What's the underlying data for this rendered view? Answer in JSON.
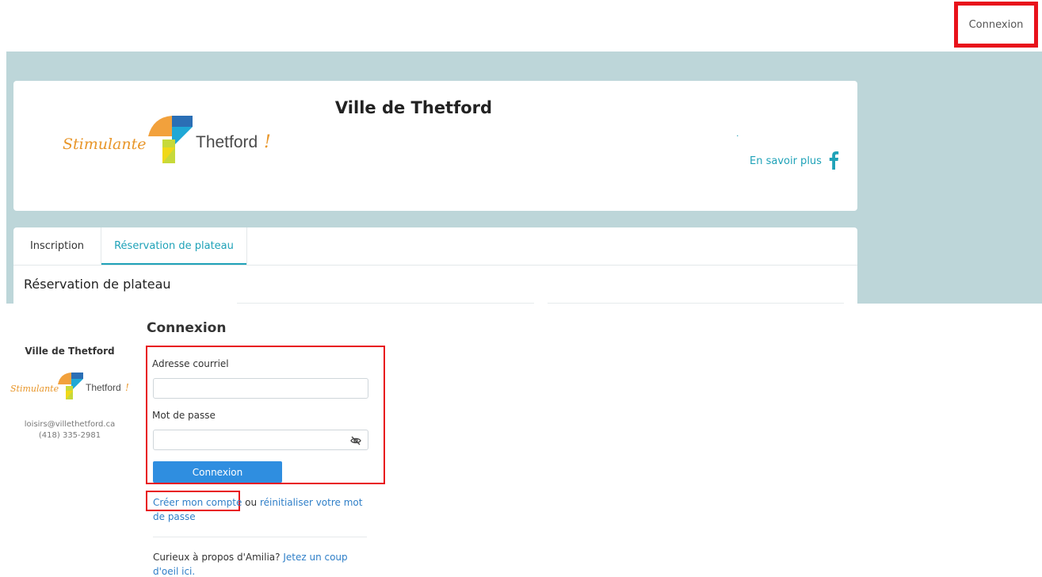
{
  "topbar": {
    "login_label": "Connexion"
  },
  "header": {
    "org_name": "Ville de Thetford",
    "logo_text_script": "Stimulante",
    "logo_text_brand": "Thetford",
    "dot": ".",
    "learn_more": "En savoir plus",
    "facebook_icon": "facebook-icon"
  },
  "tabs": [
    {
      "label": "Inscription",
      "active": false
    },
    {
      "label": "Réservation de plateau",
      "active": true
    }
  ],
  "section_title": "Réservation de plateau",
  "sidebar": {
    "org_name": "Ville de Thetford",
    "email": "loisirs@villethetford.ca",
    "phone": "(418) 335-2981"
  },
  "login": {
    "title": "Connexion",
    "email_label": "Adresse courriel",
    "email_value": "",
    "password_label": "Mot de passe",
    "password_value": "",
    "submit_label": "Connexion",
    "eye_icon": "eye-slash-icon"
  },
  "links": {
    "create_account": "Créer mon compte",
    "or_text": " ou ",
    "reset_password": "réinitialiser votre mot de passe",
    "curious_text": "Curieux à propos d'Amilia? ",
    "curious_link": "Jetez un coup d'oeil ici."
  },
  "colors": {
    "band": "#bdd6d9",
    "accent": "#1fa2b8",
    "button": "#2f8ee0",
    "highlight": "#e8121b"
  }
}
